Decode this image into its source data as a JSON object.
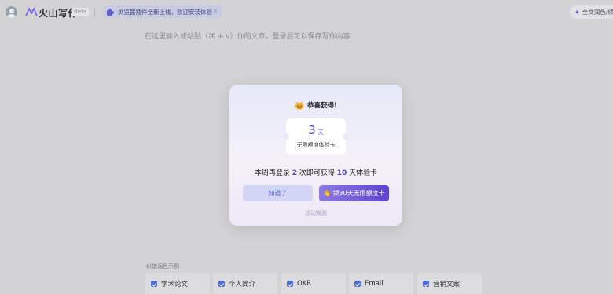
{
  "header": {
    "app_name": "火山写作",
    "beta_badge": "Beta",
    "promo_text": "浏览器插件全新上线，欢迎安装体验",
    "promo_close": "×",
    "polish_button": "全文润色/续写"
  },
  "editor": {
    "placeholder": "在这里输入或粘贴（⌘ + v）你的文章，登录后可以保存写作内容"
  },
  "modal": {
    "title": "恭喜获得!",
    "ticket_number": "3",
    "ticket_unit": "天",
    "ticket_label": "无限额度体验卡",
    "msg_prefix": "本周再登录",
    "msg_count": "2",
    "msg_middle": "次即可获得",
    "msg_days": "10",
    "msg_suffix": "天体验卡",
    "ok_button": "知道了",
    "get_button": "领30天无限额度卡",
    "get_button_icon": "👋",
    "rules_link": "活动规则"
  },
  "examples": {
    "title": "纠错润色示例",
    "items": [
      {
        "label": "学术论文"
      },
      {
        "label": "个人简介"
      },
      {
        "label": "OKR"
      },
      {
        "label": "Email"
      },
      {
        "label": "营销文案"
      }
    ]
  },
  "colors": {
    "accent": "#4f46c8",
    "backdrop": "#d3d3d6"
  }
}
